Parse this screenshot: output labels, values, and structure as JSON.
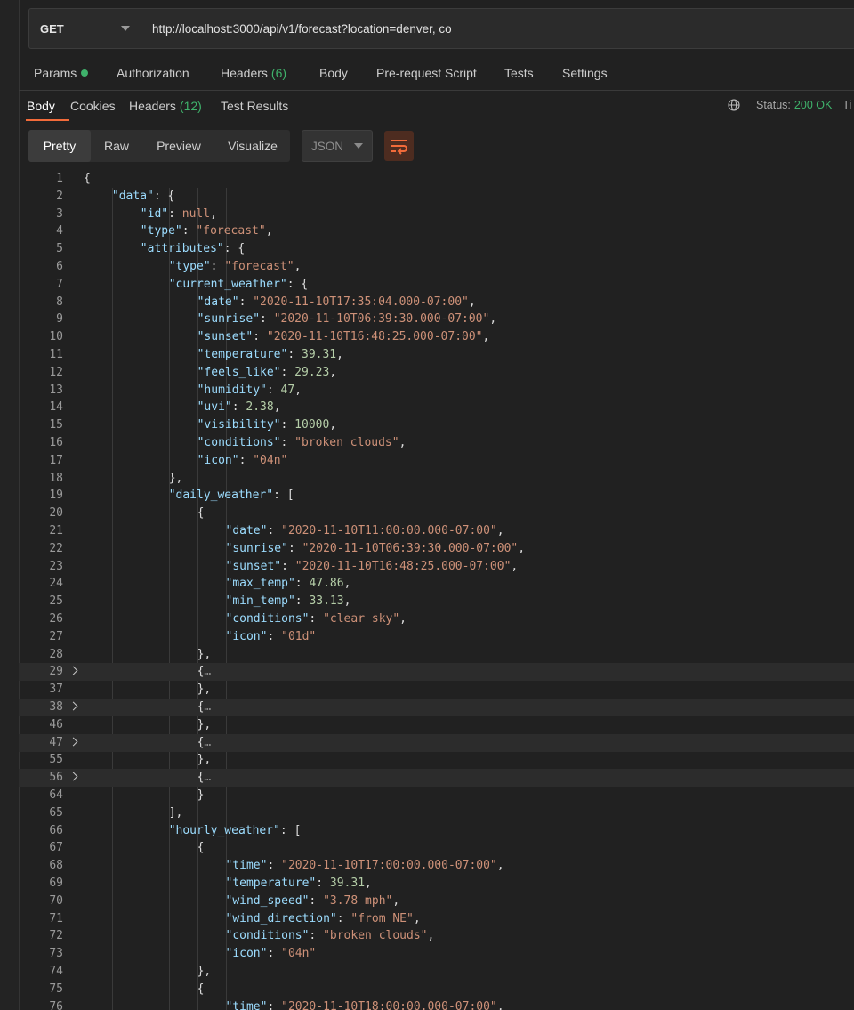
{
  "request": {
    "method": "GET",
    "url": "http://localhost:3000/api/v1/forecast?location=denver, co"
  },
  "request_tabs": [
    {
      "label": "Params",
      "dot_color": "#3fb26b"
    },
    {
      "label": "Authorization"
    },
    {
      "label": "Headers",
      "count": "(6)"
    },
    {
      "label": "Body"
    },
    {
      "label": "Pre-request Script"
    },
    {
      "label": "Tests"
    },
    {
      "label": "Settings"
    }
  ],
  "response_tabs": [
    {
      "label": "Body",
      "active": true
    },
    {
      "label": "Cookies"
    },
    {
      "label": "Headers",
      "count": "(12)"
    },
    {
      "label": "Test Results"
    }
  ],
  "status": {
    "label": "Status:",
    "value": "200 OK",
    "truncated_next": "Ti"
  },
  "viewer": {
    "modes": [
      "Pretty",
      "Raw",
      "Preview",
      "Visualize"
    ],
    "active_mode": "Pretty",
    "format": "JSON",
    "accent_color": "#f26b3a"
  },
  "code_lines": [
    {
      "n": "1",
      "indent": 0,
      "parts": [
        [
          "p",
          "{"
        ]
      ]
    },
    {
      "n": "2",
      "indent": 1,
      "parts": [
        [
          "k",
          "\"data\""
        ],
        [
          "p",
          ": {"
        ]
      ]
    },
    {
      "n": "3",
      "indent": 2,
      "parts": [
        [
          "k",
          "\"id\""
        ],
        [
          "p",
          ": "
        ],
        [
          "l",
          "null"
        ],
        [
          "p",
          ","
        ]
      ]
    },
    {
      "n": "4",
      "indent": 2,
      "parts": [
        [
          "k",
          "\"type\""
        ],
        [
          "p",
          ": "
        ],
        [
          "s",
          "\"forecast\""
        ],
        [
          "p",
          ","
        ]
      ]
    },
    {
      "n": "5",
      "indent": 2,
      "parts": [
        [
          "k",
          "\"attributes\""
        ],
        [
          "p",
          ": {"
        ]
      ]
    },
    {
      "n": "6",
      "indent": 3,
      "parts": [
        [
          "k",
          "\"type\""
        ],
        [
          "p",
          ": "
        ],
        [
          "s",
          "\"forecast\""
        ],
        [
          "p",
          ","
        ]
      ]
    },
    {
      "n": "7",
      "indent": 3,
      "parts": [
        [
          "k",
          "\"current_weather\""
        ],
        [
          "p",
          ": {"
        ]
      ]
    },
    {
      "n": "8",
      "indent": 4,
      "parts": [
        [
          "k",
          "\"date\""
        ],
        [
          "p",
          ": "
        ],
        [
          "s",
          "\"2020-11-10T17:35:04.000-07:00\""
        ],
        [
          "p",
          ","
        ]
      ]
    },
    {
      "n": "9",
      "indent": 4,
      "parts": [
        [
          "k",
          "\"sunrise\""
        ],
        [
          "p",
          ": "
        ],
        [
          "s",
          "\"2020-11-10T06:39:30.000-07:00\""
        ],
        [
          "p",
          ","
        ]
      ]
    },
    {
      "n": "10",
      "indent": 4,
      "parts": [
        [
          "k",
          "\"sunset\""
        ],
        [
          "p",
          ": "
        ],
        [
          "s",
          "\"2020-11-10T16:48:25.000-07:00\""
        ],
        [
          "p",
          ","
        ]
      ]
    },
    {
      "n": "11",
      "indent": 4,
      "parts": [
        [
          "k",
          "\"temperature\""
        ],
        [
          "p",
          ": "
        ],
        [
          "n",
          "39.31"
        ],
        [
          "p",
          ","
        ]
      ]
    },
    {
      "n": "12",
      "indent": 4,
      "parts": [
        [
          "k",
          "\"feels_like\""
        ],
        [
          "p",
          ": "
        ],
        [
          "n",
          "29.23"
        ],
        [
          "p",
          ","
        ]
      ]
    },
    {
      "n": "13",
      "indent": 4,
      "parts": [
        [
          "k",
          "\"humidity\""
        ],
        [
          "p",
          ": "
        ],
        [
          "n",
          "47"
        ],
        [
          "p",
          ","
        ]
      ]
    },
    {
      "n": "14",
      "indent": 4,
      "parts": [
        [
          "k",
          "\"uvi\""
        ],
        [
          "p",
          ": "
        ],
        [
          "n",
          "2.38"
        ],
        [
          "p",
          ","
        ]
      ]
    },
    {
      "n": "15",
      "indent": 4,
      "parts": [
        [
          "k",
          "\"visibility\""
        ],
        [
          "p",
          ": "
        ],
        [
          "n",
          "10000"
        ],
        [
          "p",
          ","
        ]
      ]
    },
    {
      "n": "16",
      "indent": 4,
      "parts": [
        [
          "k",
          "\"conditions\""
        ],
        [
          "p",
          ": "
        ],
        [
          "s",
          "\"broken clouds\""
        ],
        [
          "p",
          ","
        ]
      ]
    },
    {
      "n": "17",
      "indent": 4,
      "parts": [
        [
          "k",
          "\"icon\""
        ],
        [
          "p",
          ": "
        ],
        [
          "s",
          "\"04n\""
        ]
      ]
    },
    {
      "n": "18",
      "indent": 3,
      "parts": [
        [
          "p",
          "},"
        ]
      ]
    },
    {
      "n": "19",
      "indent": 3,
      "parts": [
        [
          "k",
          "\"daily_weather\""
        ],
        [
          "p",
          ": ["
        ]
      ]
    },
    {
      "n": "20",
      "indent": 4,
      "parts": [
        [
          "p",
          "{"
        ]
      ]
    },
    {
      "n": "21",
      "indent": 5,
      "parts": [
        [
          "k",
          "\"date\""
        ],
        [
          "p",
          ": "
        ],
        [
          "s",
          "\"2020-11-10T11:00:00.000-07:00\""
        ],
        [
          "p",
          ","
        ]
      ]
    },
    {
      "n": "22",
      "indent": 5,
      "parts": [
        [
          "k",
          "\"sunrise\""
        ],
        [
          "p",
          ": "
        ],
        [
          "s",
          "\"2020-11-10T06:39:30.000-07:00\""
        ],
        [
          "p",
          ","
        ]
      ]
    },
    {
      "n": "23",
      "indent": 5,
      "parts": [
        [
          "k",
          "\"sunset\""
        ],
        [
          "p",
          ": "
        ],
        [
          "s",
          "\"2020-11-10T16:48:25.000-07:00\""
        ],
        [
          "p",
          ","
        ]
      ]
    },
    {
      "n": "24",
      "indent": 5,
      "parts": [
        [
          "k",
          "\"max_temp\""
        ],
        [
          "p",
          ": "
        ],
        [
          "n",
          "47.86"
        ],
        [
          "p",
          ","
        ]
      ]
    },
    {
      "n": "25",
      "indent": 5,
      "parts": [
        [
          "k",
          "\"min_temp\""
        ],
        [
          "p",
          ": "
        ],
        [
          "n",
          "33.13"
        ],
        [
          "p",
          ","
        ]
      ]
    },
    {
      "n": "26",
      "indent": 5,
      "parts": [
        [
          "k",
          "\"conditions\""
        ],
        [
          "p",
          ": "
        ],
        [
          "s",
          "\"clear sky\""
        ],
        [
          "p",
          ","
        ]
      ]
    },
    {
      "n": "27",
      "indent": 5,
      "parts": [
        [
          "k",
          "\"icon\""
        ],
        [
          "p",
          ": "
        ],
        [
          "s",
          "\"01d\""
        ]
      ]
    },
    {
      "n": "28",
      "indent": 4,
      "parts": [
        [
          "p",
          "},"
        ]
      ]
    },
    {
      "n": "29",
      "indent": 4,
      "folded": true,
      "parts": [
        [
          "p",
          "{"
        ],
        [
          "e",
          "…"
        ]
      ]
    },
    {
      "n": "37",
      "indent": 4,
      "parts": [
        [
          "p",
          "},"
        ]
      ]
    },
    {
      "n": "38",
      "indent": 4,
      "folded": true,
      "parts": [
        [
          "p",
          "{"
        ],
        [
          "e",
          "…"
        ]
      ]
    },
    {
      "n": "46",
      "indent": 4,
      "parts": [
        [
          "p",
          "},"
        ]
      ]
    },
    {
      "n": "47",
      "indent": 4,
      "folded": true,
      "parts": [
        [
          "p",
          "{"
        ],
        [
          "e",
          "…"
        ]
      ]
    },
    {
      "n": "55",
      "indent": 4,
      "parts": [
        [
          "p",
          "},"
        ]
      ]
    },
    {
      "n": "56",
      "indent": 4,
      "folded": true,
      "parts": [
        [
          "p",
          "{"
        ],
        [
          "e",
          "…"
        ]
      ]
    },
    {
      "n": "64",
      "indent": 4,
      "parts": [
        [
          "p",
          "}"
        ]
      ]
    },
    {
      "n": "65",
      "indent": 3,
      "parts": [
        [
          "p",
          "],"
        ]
      ]
    },
    {
      "n": "66",
      "indent": 3,
      "parts": [
        [
          "k",
          "\"hourly_weather\""
        ],
        [
          "p",
          ": ["
        ]
      ]
    },
    {
      "n": "67",
      "indent": 4,
      "parts": [
        [
          "p",
          "{"
        ]
      ]
    },
    {
      "n": "68",
      "indent": 5,
      "parts": [
        [
          "k",
          "\"time\""
        ],
        [
          "p",
          ": "
        ],
        [
          "s",
          "\"2020-11-10T17:00:00.000-07:00\""
        ],
        [
          "p",
          ","
        ]
      ]
    },
    {
      "n": "69",
      "indent": 5,
      "parts": [
        [
          "k",
          "\"temperature\""
        ],
        [
          "p",
          ": "
        ],
        [
          "n",
          "39.31"
        ],
        [
          "p",
          ","
        ]
      ]
    },
    {
      "n": "70",
      "indent": 5,
      "parts": [
        [
          "k",
          "\"wind_speed\""
        ],
        [
          "p",
          ": "
        ],
        [
          "s",
          "\"3.78 mph\""
        ],
        [
          "p",
          ","
        ]
      ]
    },
    {
      "n": "71",
      "indent": 5,
      "parts": [
        [
          "k",
          "\"wind_direction\""
        ],
        [
          "p",
          ": "
        ],
        [
          "s",
          "\"from NE\""
        ],
        [
          "p",
          ","
        ]
      ]
    },
    {
      "n": "72",
      "indent": 5,
      "parts": [
        [
          "k",
          "\"conditions\""
        ],
        [
          "p",
          ": "
        ],
        [
          "s",
          "\"broken clouds\""
        ],
        [
          "p",
          ","
        ]
      ]
    },
    {
      "n": "73",
      "indent": 5,
      "parts": [
        [
          "k",
          "\"icon\""
        ],
        [
          "p",
          ": "
        ],
        [
          "s",
          "\"04n\""
        ]
      ]
    },
    {
      "n": "74",
      "indent": 4,
      "parts": [
        [
          "p",
          "},"
        ]
      ]
    },
    {
      "n": "75",
      "indent": 4,
      "parts": [
        [
          "p",
          "{"
        ]
      ]
    },
    {
      "n": "76",
      "indent": 5,
      "parts": [
        [
          "k",
          "\"time\""
        ],
        [
          "p",
          ": "
        ],
        [
          "s",
          "\"2020-11-10T18:00:00.000-07:00\""
        ],
        [
          "p",
          ","
        ]
      ]
    }
  ]
}
